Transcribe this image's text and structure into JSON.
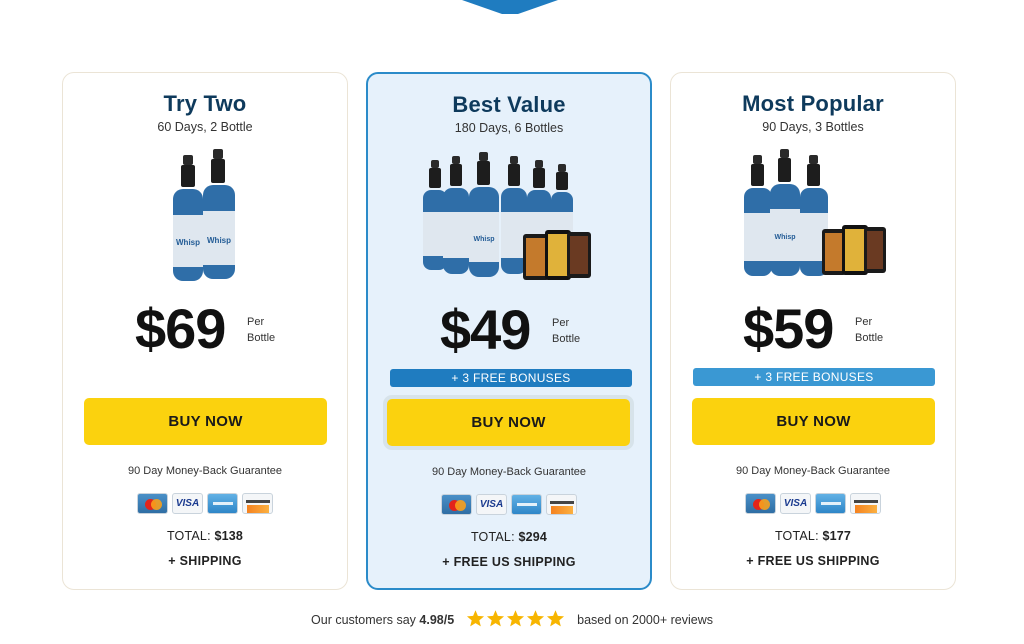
{
  "offers": [
    {
      "title": "Try Two",
      "subtitle": "60 Days, 2 Bottle",
      "price": "$69",
      "per_label_1": "Per",
      "per_label_2": "Bottle",
      "bonus": "",
      "cta": "BUY NOW",
      "guarantee": "90 Day Money-Back Guarantee",
      "total_label": "TOTAL:",
      "total_value": "$138",
      "shipping": "+ SHIPPING",
      "bottle_count": 2
    },
    {
      "title": "Best Value",
      "subtitle": "180 Days, 6 Bottles",
      "price": "$49",
      "per_label_1": "Per",
      "per_label_2": "Bottle",
      "bonus": "+ 3 FREE BONUSES",
      "cta": "BUY NOW",
      "guarantee": "90 Day Money-Back Guarantee",
      "total_label": "TOTAL:",
      "total_value": "$294",
      "shipping": "+ FREE US SHIPPING",
      "bottle_count": 6
    },
    {
      "title": "Most Popular",
      "subtitle": "90 Days, 3 Bottles",
      "price": "$59",
      "per_label_1": "Per",
      "per_label_2": "Bottle",
      "bonus": "+ 3 FREE BONUSES",
      "cta": "BUY NOW",
      "guarantee": "90 Day Money-Back Guarantee",
      "total_label": "TOTAL:",
      "total_value": "$177",
      "shipping": "+ FREE US SHIPPING",
      "bottle_count": 3
    }
  ],
  "payment_icons": [
    "mastercard-icon",
    "visa-icon",
    "amex-icon",
    "discover-icon"
  ],
  "payment_visa_text": "VISA",
  "product_label": "Whispeara",
  "reviews": {
    "prefix": "Our customers say",
    "rating": "4.98/5",
    "suffix": "based on 2000+ reviews",
    "stars": 5
  },
  "colors": {
    "title": "#0e3a5c",
    "featured_bg": "#e6f1fb",
    "featured_border": "#2b8bc9",
    "cta": "#fbd20e",
    "bonus": "#1f7cc0",
    "star": "#f7b500"
  }
}
